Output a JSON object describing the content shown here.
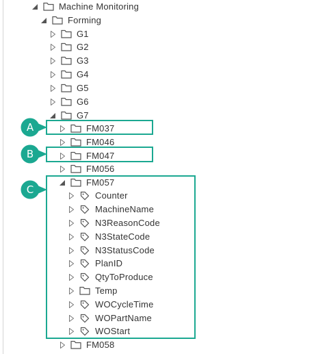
{
  "tree": {
    "root": {
      "label": "Machine Monitoring"
    },
    "forming": {
      "label": "Forming"
    },
    "groups": [
      {
        "label": "G1"
      },
      {
        "label": "G2"
      },
      {
        "label": "G3"
      },
      {
        "label": "G4"
      },
      {
        "label": "G5"
      },
      {
        "label": "G6"
      }
    ],
    "g7": {
      "label": "G7",
      "children": {
        "fm037": {
          "label": "FM037"
        },
        "fm046": {
          "label": "FM046"
        },
        "fm047": {
          "label": "FM047"
        },
        "fm056": {
          "label": "FM056"
        },
        "fm057": {
          "label": "FM057",
          "items": [
            {
              "label": "Counter",
              "icon": "tag-icon"
            },
            {
              "label": "MachineName",
              "icon": "tag-icon"
            },
            {
              "label": "N3ReasonCode",
              "icon": "tag-icon"
            },
            {
              "label": "N3StateCode",
              "icon": "tag-icon"
            },
            {
              "label": "N3StatusCode",
              "icon": "tag-icon"
            },
            {
              "label": "PlanID",
              "icon": "tag-icon"
            },
            {
              "label": "QtyToProduce",
              "icon": "tag-icon"
            },
            {
              "label": "Temp",
              "icon": "folder-icon"
            },
            {
              "label": "WOCycleTime",
              "icon": "tag-icon"
            },
            {
              "label": "WOPartName",
              "icon": "tag-icon"
            },
            {
              "label": "WOStart",
              "icon": "tag-icon"
            }
          ]
        },
        "fm058": {
          "label": "FM058"
        }
      }
    }
  },
  "callouts": {
    "a": "A",
    "b": "B",
    "c": "C"
  },
  "colors": {
    "highlight": "#1ba891",
    "text": "#333333",
    "icon": "#555555"
  }
}
